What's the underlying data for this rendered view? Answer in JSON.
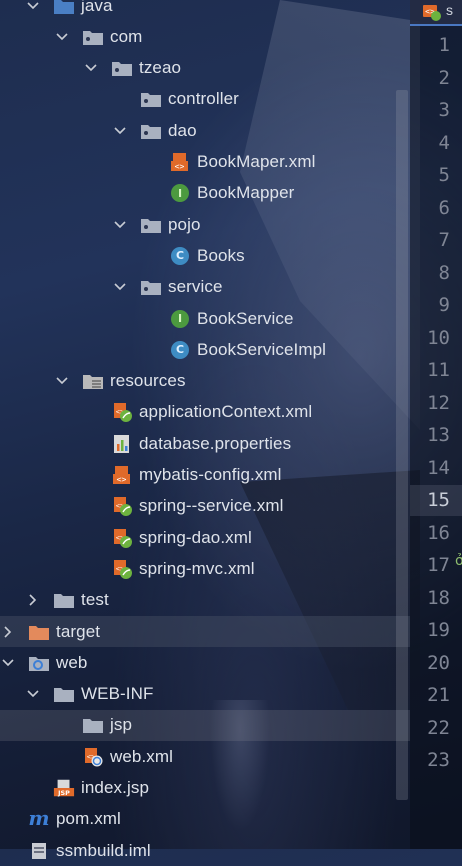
{
  "colors": {
    "folder": "#a9b1c0",
    "folder_excluded": "#e38a5c",
    "folder_resources": "#b9b9b9",
    "xml_orange": "#e06a2a",
    "spring_green": "#6db33f",
    "interface_badge": "#4c9a3f",
    "class_badge": "#3e8cc3",
    "maven_blue": "#3d7fd6",
    "text": "#dfe3ea",
    "line_number": "#7f8594"
  },
  "tree": [
    {
      "label": "java",
      "icon": "folder-source-icon",
      "arrow": "expanded",
      "indent": 5
    },
    {
      "label": "com",
      "icon": "package-icon",
      "arrow": "expanded",
      "indent": 6
    },
    {
      "label": "tzeao",
      "icon": "package-icon",
      "arrow": "expanded",
      "indent": 7
    },
    {
      "label": "controller",
      "icon": "package-icon",
      "arrow": "none",
      "indent": 8
    },
    {
      "label": "dao",
      "icon": "package-icon",
      "arrow": "expanded",
      "indent": 8
    },
    {
      "label": "BookMaper.xml",
      "icon": "xml-file-icon",
      "arrow": "none",
      "indent": 9
    },
    {
      "label": "BookMapper",
      "icon": "interface-icon",
      "arrow": "none",
      "indent": 9
    },
    {
      "label": "pojo",
      "icon": "package-icon",
      "arrow": "expanded",
      "indent": 8
    },
    {
      "label": "Books",
      "icon": "class-icon",
      "arrow": "none",
      "indent": 9
    },
    {
      "label": "service",
      "icon": "package-icon",
      "arrow": "expanded",
      "indent": 8
    },
    {
      "label": "BookService",
      "icon": "interface-icon",
      "arrow": "none",
      "indent": 9
    },
    {
      "label": "BookServiceImpl",
      "icon": "class-icon",
      "arrow": "none",
      "indent": 9
    },
    {
      "label": "resources",
      "icon": "resources-folder-icon",
      "arrow": "expanded",
      "indent": 6
    },
    {
      "label": "applicationContext.xml",
      "icon": "spring-xml-icon",
      "arrow": "none",
      "indent": 7
    },
    {
      "label": "database.properties",
      "icon": "properties-file-icon",
      "arrow": "none",
      "indent": 7
    },
    {
      "label": "mybatis-config.xml",
      "icon": "xml-file-icon",
      "arrow": "none",
      "indent": 7
    },
    {
      "label": "spring--service.xml",
      "icon": "spring-xml-icon",
      "arrow": "none",
      "indent": 7
    },
    {
      "label": "spring-dao.xml",
      "icon": "spring-xml-icon",
      "arrow": "none",
      "indent": 7
    },
    {
      "label": "spring-mvc.xml",
      "icon": "spring-xml-icon",
      "arrow": "none",
      "indent": 7
    },
    {
      "label": "test",
      "icon": "folder-icon",
      "arrow": "collapsed",
      "indent": 5
    },
    {
      "label": "target",
      "icon": "excluded-folder-icon",
      "arrow": "collapsed",
      "indent": 4
    },
    {
      "label": "web",
      "icon": "web-folder-icon",
      "arrow": "expanded",
      "indent": 4
    },
    {
      "label": "WEB-INF",
      "icon": "folder-icon",
      "arrow": "expanded",
      "indent": 5
    },
    {
      "label": "jsp",
      "icon": "folder-icon",
      "arrow": "none",
      "indent": 6
    },
    {
      "label": "web.xml",
      "icon": "web-xml-icon",
      "arrow": "none",
      "indent": 6
    },
    {
      "label": "index.jsp",
      "icon": "jsp-file-icon",
      "arrow": "none",
      "indent": 5
    },
    {
      "label": "pom.xml",
      "icon": "maven-icon",
      "arrow": "none",
      "indent": 4
    },
    {
      "label": "ssmbuild.iml",
      "icon": "iml-file-icon",
      "arrow": "none",
      "indent": 4
    }
  ],
  "editor": {
    "tab_label": "s",
    "line_numbers": [
      "1",
      "2",
      "3",
      "4",
      "5",
      "6",
      "7",
      "8",
      "9",
      "10",
      "11",
      "12",
      "13",
      "14",
      "15",
      "16",
      "17",
      "18",
      "19",
      "20",
      "21",
      "22",
      "23"
    ],
    "current_line": "15"
  }
}
